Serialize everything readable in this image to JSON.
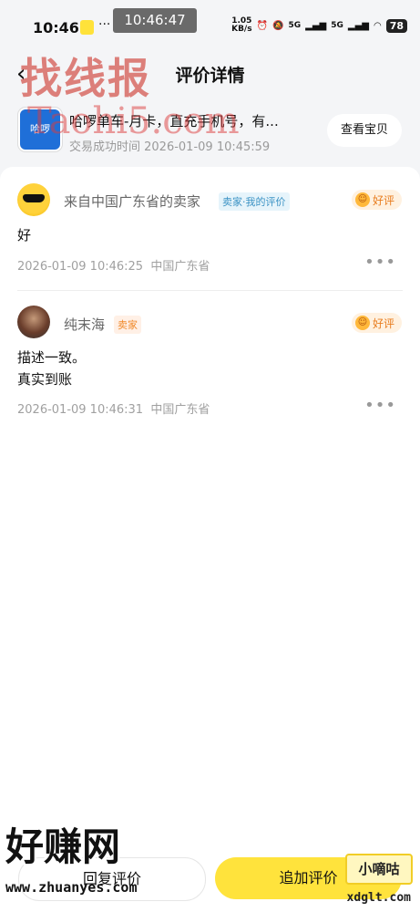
{
  "status_bar": {
    "time": "10:46",
    "overlay_clock": "10:46:47",
    "net_speed": "1.05",
    "net_unit": "KB/s",
    "sim1": "5G",
    "sim2": "5G",
    "battery": "78"
  },
  "header": {
    "title": "评价详情"
  },
  "product": {
    "title": "哈啰单车-月卡，直充手机号，有...",
    "image_label": "哈啰",
    "time": "交易成功时间 2026-01-09 10:45:59",
    "view_button": "查看宝贝"
  },
  "reviews": [
    {
      "name": "来自中国广东省的卖家",
      "tag": "卖家·我的评价",
      "rating": "好评",
      "text": [
        "好"
      ],
      "timestamp": "2026-01-09 10:46:25",
      "location": "中国广东省"
    },
    {
      "name": "纯末海",
      "tag": "卖家",
      "rating": "好评",
      "text": [
        "描述一致。",
        "真实到账"
      ],
      "timestamp": "2026-01-09 10:46:31",
      "location": "中国广东省"
    }
  ],
  "bottom_bar": {
    "reply_button": "回复评价",
    "add_button": "追加评价"
  },
  "watermarks": {
    "top": "找线报",
    "top_url": "Taohi5.com",
    "bottom": "好赚网",
    "bottom_url": "www.zhuanyes.com",
    "right": "小嘀咕",
    "right_url": "xdglt.com"
  },
  "colors": {
    "accent_yellow": "#ffe33c",
    "good_rating": "#e87d1f",
    "seller_tag": "#3a92c4"
  }
}
